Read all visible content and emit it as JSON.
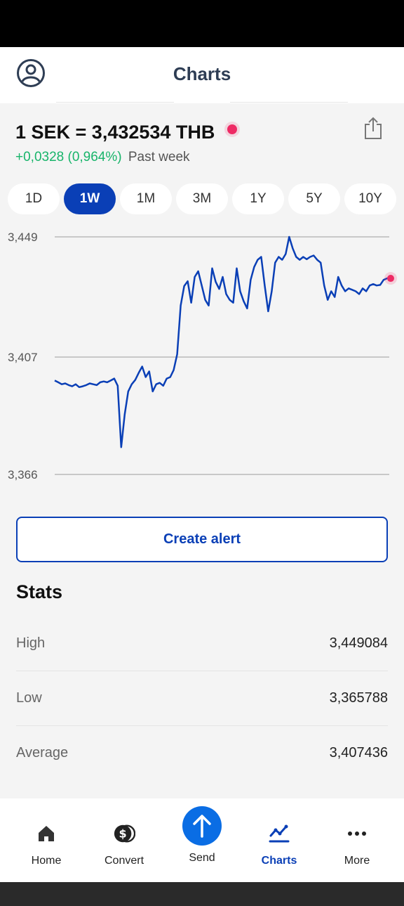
{
  "header": {
    "title": "Charts"
  },
  "rate": {
    "text": "1 SEK = 3,432534 THB",
    "change": "+0,0328 (0,964%)",
    "period_label": "Past week"
  },
  "periods": [
    {
      "label": "1D",
      "active": false
    },
    {
      "label": "1W",
      "active": true
    },
    {
      "label": "1M",
      "active": false
    },
    {
      "label": "3M",
      "active": false
    },
    {
      "label": "1Y",
      "active": false
    },
    {
      "label": "5Y",
      "active": false
    },
    {
      "label": "10Y",
      "active": false
    }
  ],
  "chart_data": {
    "type": "line",
    "series": [
      {
        "values": [
          3.3988,
          3.3982,
          3.3975,
          3.3978,
          3.3972,
          3.3968,
          3.3975,
          3.3965,
          3.3968,
          3.3972,
          3.3978,
          3.3975,
          3.3972,
          3.3982,
          3.3985,
          3.3982,
          3.3988,
          3.3995,
          3.397,
          3.3755,
          3.387,
          3.395,
          3.3975,
          3.399,
          3.4015,
          3.4037,
          3.4,
          3.402,
          3.395,
          3.3975,
          3.398,
          3.397,
          3.3995,
          3.4,
          3.4025,
          3.408,
          3.425,
          3.4318,
          3.4335,
          3.426,
          3.435,
          3.437,
          3.432,
          3.427,
          3.425,
          3.438,
          3.4333,
          3.4308,
          3.435,
          3.429,
          3.427,
          3.426,
          3.438,
          3.43,
          3.4265,
          3.424,
          3.434,
          3.4385,
          3.441,
          3.442,
          3.432,
          3.423,
          3.43,
          3.44,
          3.442,
          3.441,
          3.443,
          3.449,
          3.445,
          3.442,
          3.441,
          3.442,
          3.4412,
          3.442,
          3.4425,
          3.441,
          3.44,
          3.432,
          3.427,
          3.43,
          3.428,
          3.435,
          3.432,
          3.43,
          3.431,
          3.4305,
          3.43,
          3.429,
          3.431,
          3.43,
          3.432,
          3.4325,
          3.432,
          3.4322,
          3.434,
          3.4345,
          3.4345
        ]
      }
    ],
    "yticks": [
      "3,449",
      "3,407",
      "3,366"
    ],
    "ylim": [
      3.366,
      3.449
    ],
    "grid": true,
    "line_color": "#0a3fb6",
    "marker_color": "#ee2a64"
  },
  "actions": {
    "create_alert": "Create alert"
  },
  "stats": {
    "title": "Stats",
    "rows": [
      {
        "label": "High",
        "value": "3,449084"
      },
      {
        "label": "Low",
        "value": "3,365788"
      },
      {
        "label": "Average",
        "value": "3,407436"
      }
    ]
  },
  "nav": {
    "items": [
      {
        "label": "Home",
        "icon": "home-icon"
      },
      {
        "label": "Convert",
        "icon": "dollar-coins-icon"
      },
      {
        "label": "Send",
        "icon": "arrow-up-icon"
      },
      {
        "label": "Charts",
        "icon": "chart-icon",
        "active": true
      },
      {
        "label": "More",
        "icon": "more-dots-icon"
      }
    ]
  },
  "colors": {
    "brand_blue": "#0a3fb6",
    "send_blue": "#0a6de4",
    "positive": "#18b46a",
    "live_dot": "#ee2a64"
  }
}
